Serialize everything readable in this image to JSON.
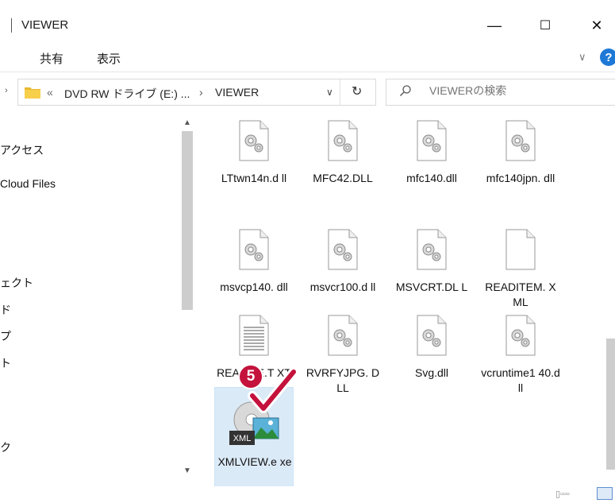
{
  "window": {
    "title": "VIEWER",
    "minimize_glyph": "—",
    "maximize_glyph": "☐",
    "close_glyph": "✕"
  },
  "ribbon": {
    "tabs": [
      "共有",
      "表示"
    ],
    "expand_glyph": "∨",
    "help_glyph": "?"
  },
  "address": {
    "overflow_glyph": "«",
    "crumbs": [
      "DVD RW ドライブ (E:) ...",
      "VIEWER"
    ],
    "separator": "›",
    "dropdown_glyph": "∨",
    "refresh_glyph": "↻",
    "search_placeholder": "VIEWERの検索"
  },
  "nav": {
    "items": [
      "アクセス",
      "Cloud Files",
      "ェクト",
      "ド",
      "プ",
      "ト",
      "ク"
    ]
  },
  "files": [
    {
      "name": "LTtwn14n.dll",
      "label": "LTtwn14n.d ll",
      "icon": "dll-gear-icon"
    },
    {
      "name": "MFC42.DLL",
      "label": "MFC42.DLL",
      "icon": "dll-gear-icon"
    },
    {
      "name": "mfc140.dll",
      "label": "mfc140.dll",
      "icon": "dll-gear-icon"
    },
    {
      "name": "mfc140jpn.dll",
      "label": "mfc140jpn. dll",
      "icon": "dll-gear-icon"
    },
    {
      "name": "msvcp140.dll",
      "label": "msvcp140. dll",
      "icon": "dll-gear-icon"
    },
    {
      "name": "msvcr100.dll",
      "label": "msvcr100.d ll",
      "icon": "dll-gear-icon"
    },
    {
      "name": "MSVCRT.DLL",
      "label": "MSVCRT.DL L",
      "icon": "dll-gear-icon"
    },
    {
      "name": "READITEM.XML",
      "label": "READITEM. XML",
      "icon": "blank-file-icon"
    },
    {
      "name": "README.TXT",
      "label": "README.T XT",
      "icon": "text-file-icon"
    },
    {
      "name": "RVRFYJPG.DLL",
      "label": "RVRFYJPG. DLL",
      "icon": "dll-gear-icon"
    },
    {
      "name": "Svg.dll",
      "label": "Svg.dll",
      "icon": "dll-gear-icon"
    },
    {
      "name": "vcruntime140.dll",
      "label": "vcruntime1 40.dll",
      "icon": "dll-gear-icon"
    },
    {
      "name": "XMLVIEW.exe",
      "label": "XMLVIEW.e xe",
      "icon": "xmlview-app-icon",
      "badge": "XML"
    }
  ],
  "step_badge": "5",
  "colors": {
    "accent": "#1e78d6",
    "badge": "#c4123c",
    "selection": "#dbeaf7"
  }
}
